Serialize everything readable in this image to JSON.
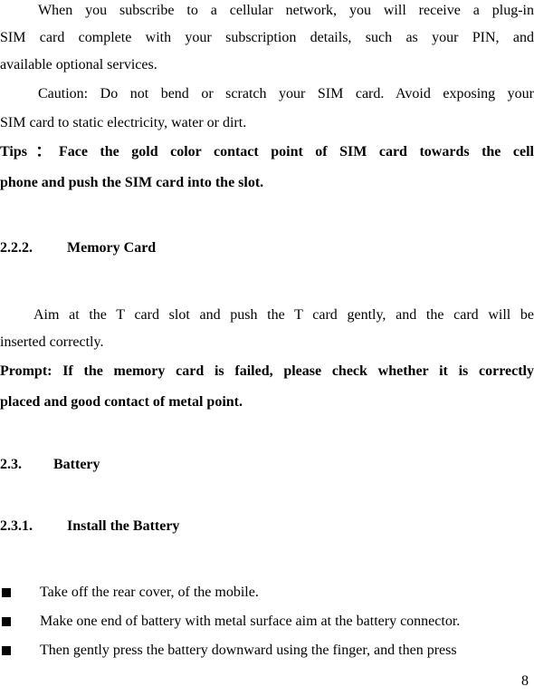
{
  "page": {
    "paragraphs": {
      "sim_intro": [
        "When you subscribe to a cellular network, you will receive a plug-in",
        "SIM card complete with your subscription details, such as your PIN, and",
        "available optional services."
      ],
      "caution": [
        "Caution: Do not bend or scratch your SIM card. Avoid exposing your",
        "SIM card to static electricity, water or dirt."
      ],
      "tips": [
        "Tips：Face the gold color contact point of SIM card towards the cell",
        "phone and push the SIM card into the slot."
      ],
      "memory_body": [
        "Aim at the T card slot and push the T card gently, and the card will be",
        "inserted correctly."
      ],
      "prompt": [
        "Prompt: If the memory card is failed, please check whether it is correctly",
        "placed and good contact of metal point."
      ]
    },
    "headings": {
      "memory_card": {
        "number": "2.2.2.",
        "title": "Memory Card"
      },
      "battery": {
        "number": "2.3.",
        "title": "Battery"
      },
      "install_battery": {
        "number": "2.3.1.",
        "title": "Install the Battery"
      }
    },
    "bullets": [
      "Take off the rear cover, of the mobile.",
      "Make one end of battery with metal surface aim at the battery connector.",
      "Then gently press the battery downward using the finger, and then press"
    ],
    "page_number": "8"
  }
}
